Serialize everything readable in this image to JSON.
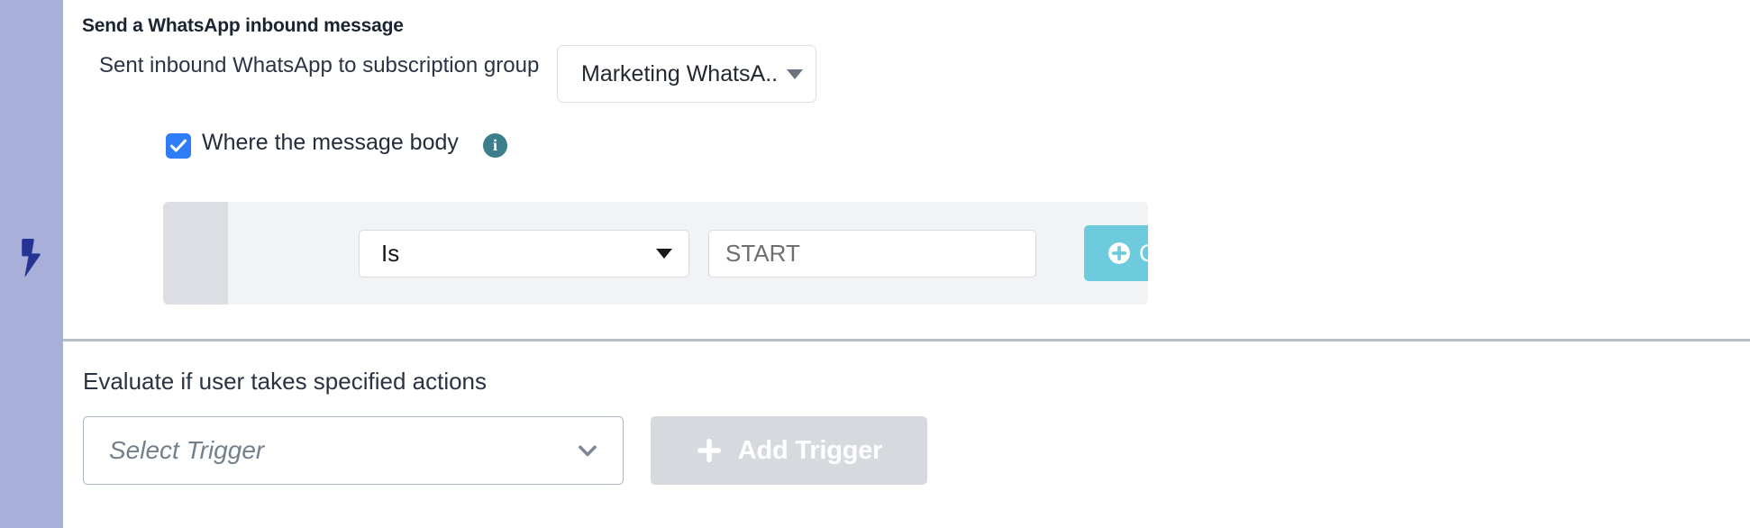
{
  "colors": {
    "rail": "#a8afd8",
    "bolt": "#253494",
    "checkbox": "#2f7df6",
    "info_badge": "#3c7e8c",
    "or_button": "#6ecbdd",
    "add_trigger_disabled": "#d6dade",
    "panel": "#f2f3f5",
    "panel_grip": "#dddee3",
    "divider": "#b6bec8"
  },
  "rail": {
    "icon": "lightning-bolt-icon"
  },
  "card": {
    "title": "Send a WhatsApp inbound message",
    "close_icon": "close-icon",
    "subscription": {
      "label": "Sent inbound WhatsApp to subscription group",
      "selected_value": "Marketing WhatsA...",
      "caret_icon": "caret-down-icon"
    },
    "checkbox": {
      "checked": true,
      "label": "Where the message body",
      "check_icon": "check-icon",
      "info_icon": "info-icon",
      "info_glyph": "i"
    },
    "condition": {
      "grip_icon": "drag-handle",
      "operator": {
        "selected_value": "Is",
        "caret_icon": "caret-down-icon"
      },
      "value_input": {
        "value": "",
        "placeholder": "START"
      },
      "or_button": {
        "label": "OR",
        "icon": "plus-circle-icon"
      },
      "remove_icon": "close-icon"
    }
  },
  "trigger_section": {
    "heading": "Evaluate if user takes specified actions",
    "select": {
      "value": "",
      "placeholder": "Select Trigger",
      "chevron_icon": "chevron-down-icon"
    },
    "add_button": {
      "label": "Add Trigger",
      "icon": "plus-icon",
      "disabled": true
    }
  }
}
